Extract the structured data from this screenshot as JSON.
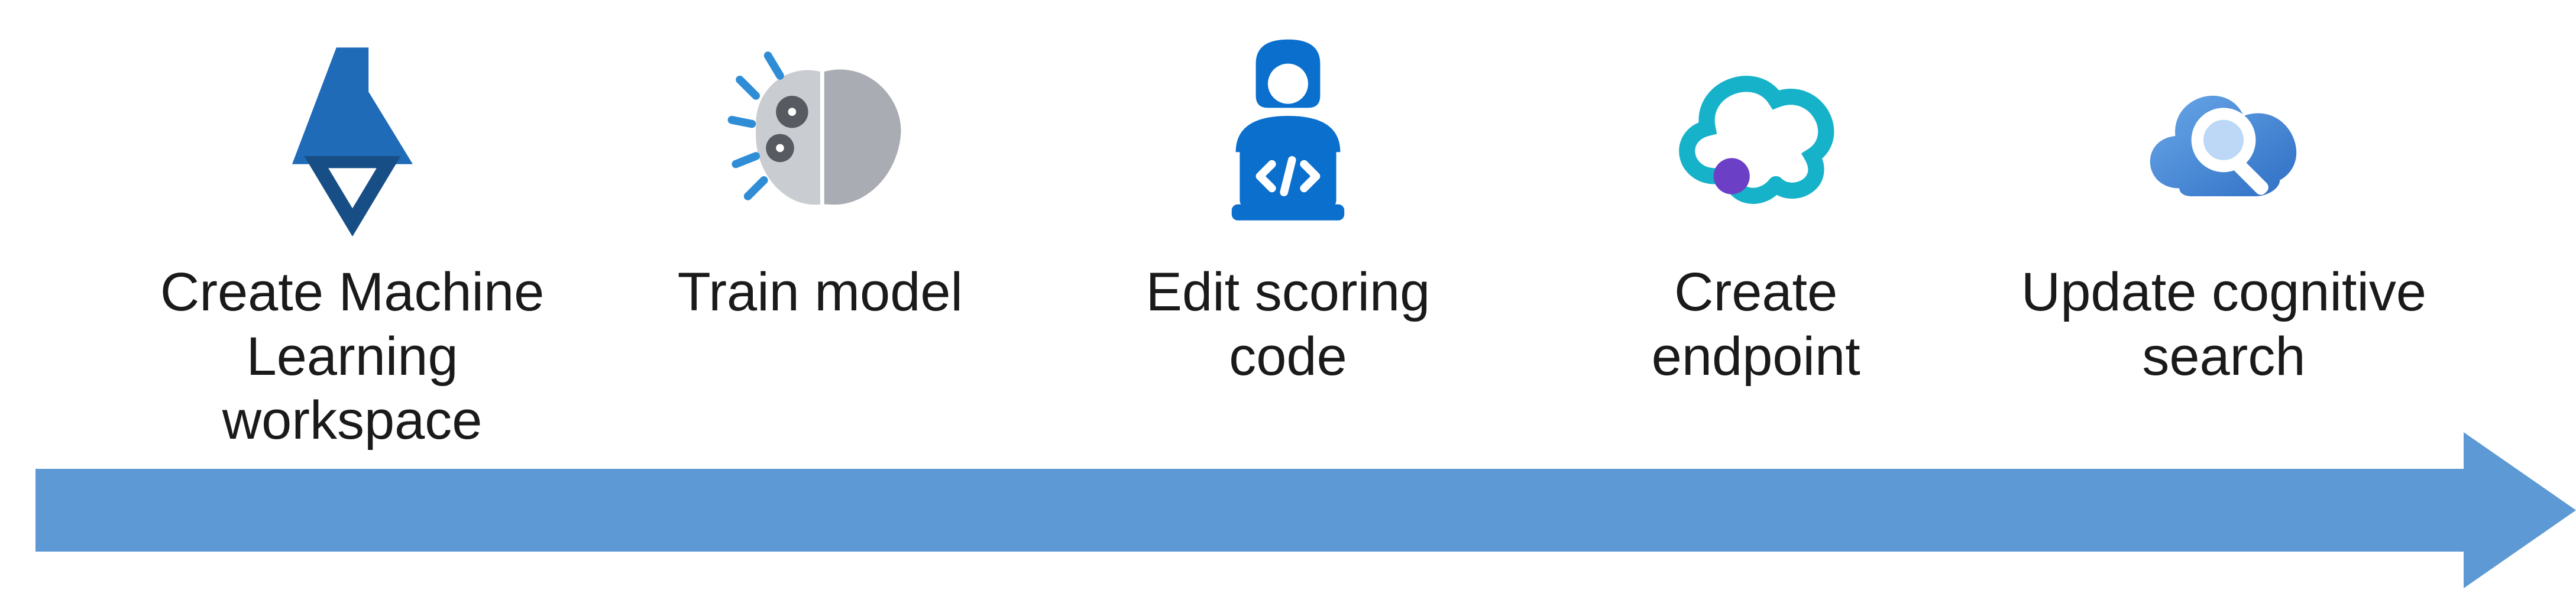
{
  "diagram": {
    "type": "process-flow",
    "direction": "left-to-right",
    "arrow_color": "#5d99d4",
    "steps": [
      {
        "label": "Create Machine\nLearning workspace",
        "icon": "flask-ml-icon"
      },
      {
        "label": "Train model",
        "icon": "brain-gears-icon"
      },
      {
        "label": "Edit scoring\ncode",
        "icon": "developer-code-icon"
      },
      {
        "label": "Create\nendpoint",
        "icon": "cloud-endpoint-icon"
      },
      {
        "label": "Update cognitive\nsearch",
        "icon": "cloud-search-icon"
      }
    ]
  }
}
